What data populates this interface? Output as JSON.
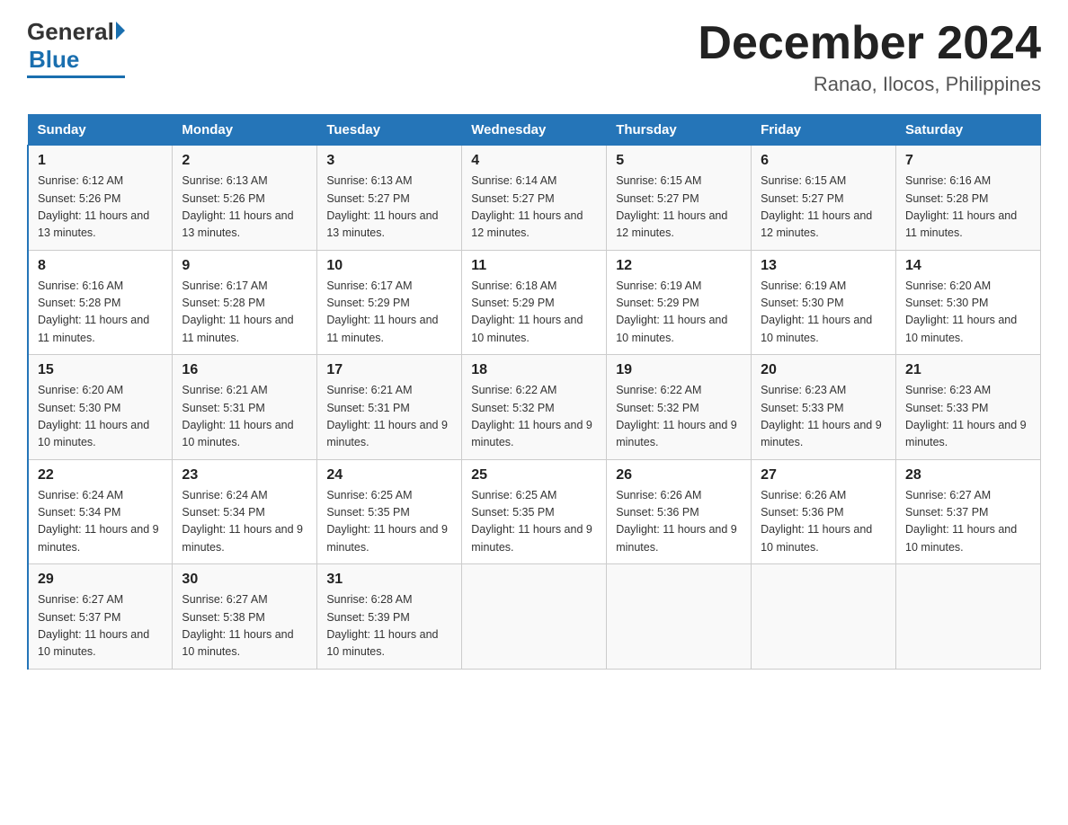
{
  "logo": {
    "general": "General",
    "blue": "Blue"
  },
  "title": "December 2024",
  "location": "Ranao, Ilocos, Philippines",
  "days_of_week": [
    "Sunday",
    "Monday",
    "Tuesday",
    "Wednesday",
    "Thursday",
    "Friday",
    "Saturday"
  ],
  "weeks": [
    [
      {
        "day": "1",
        "sunrise": "Sunrise: 6:12 AM",
        "sunset": "Sunset: 5:26 PM",
        "daylight": "Daylight: 11 hours and 13 minutes."
      },
      {
        "day": "2",
        "sunrise": "Sunrise: 6:13 AM",
        "sunset": "Sunset: 5:26 PM",
        "daylight": "Daylight: 11 hours and 13 minutes."
      },
      {
        "day": "3",
        "sunrise": "Sunrise: 6:13 AM",
        "sunset": "Sunset: 5:27 PM",
        "daylight": "Daylight: 11 hours and 13 minutes."
      },
      {
        "day": "4",
        "sunrise": "Sunrise: 6:14 AM",
        "sunset": "Sunset: 5:27 PM",
        "daylight": "Daylight: 11 hours and 12 minutes."
      },
      {
        "day": "5",
        "sunrise": "Sunrise: 6:15 AM",
        "sunset": "Sunset: 5:27 PM",
        "daylight": "Daylight: 11 hours and 12 minutes."
      },
      {
        "day": "6",
        "sunrise": "Sunrise: 6:15 AM",
        "sunset": "Sunset: 5:27 PM",
        "daylight": "Daylight: 11 hours and 12 minutes."
      },
      {
        "day": "7",
        "sunrise": "Sunrise: 6:16 AM",
        "sunset": "Sunset: 5:28 PM",
        "daylight": "Daylight: 11 hours and 11 minutes."
      }
    ],
    [
      {
        "day": "8",
        "sunrise": "Sunrise: 6:16 AM",
        "sunset": "Sunset: 5:28 PM",
        "daylight": "Daylight: 11 hours and 11 minutes."
      },
      {
        "day": "9",
        "sunrise": "Sunrise: 6:17 AM",
        "sunset": "Sunset: 5:28 PM",
        "daylight": "Daylight: 11 hours and 11 minutes."
      },
      {
        "day": "10",
        "sunrise": "Sunrise: 6:17 AM",
        "sunset": "Sunset: 5:29 PM",
        "daylight": "Daylight: 11 hours and 11 minutes."
      },
      {
        "day": "11",
        "sunrise": "Sunrise: 6:18 AM",
        "sunset": "Sunset: 5:29 PM",
        "daylight": "Daylight: 11 hours and 10 minutes."
      },
      {
        "day": "12",
        "sunrise": "Sunrise: 6:19 AM",
        "sunset": "Sunset: 5:29 PM",
        "daylight": "Daylight: 11 hours and 10 minutes."
      },
      {
        "day": "13",
        "sunrise": "Sunrise: 6:19 AM",
        "sunset": "Sunset: 5:30 PM",
        "daylight": "Daylight: 11 hours and 10 minutes."
      },
      {
        "day": "14",
        "sunrise": "Sunrise: 6:20 AM",
        "sunset": "Sunset: 5:30 PM",
        "daylight": "Daylight: 11 hours and 10 minutes."
      }
    ],
    [
      {
        "day": "15",
        "sunrise": "Sunrise: 6:20 AM",
        "sunset": "Sunset: 5:30 PM",
        "daylight": "Daylight: 11 hours and 10 minutes."
      },
      {
        "day": "16",
        "sunrise": "Sunrise: 6:21 AM",
        "sunset": "Sunset: 5:31 PM",
        "daylight": "Daylight: 11 hours and 10 minutes."
      },
      {
        "day": "17",
        "sunrise": "Sunrise: 6:21 AM",
        "sunset": "Sunset: 5:31 PM",
        "daylight": "Daylight: 11 hours and 9 minutes."
      },
      {
        "day": "18",
        "sunrise": "Sunrise: 6:22 AM",
        "sunset": "Sunset: 5:32 PM",
        "daylight": "Daylight: 11 hours and 9 minutes."
      },
      {
        "day": "19",
        "sunrise": "Sunrise: 6:22 AM",
        "sunset": "Sunset: 5:32 PM",
        "daylight": "Daylight: 11 hours and 9 minutes."
      },
      {
        "day": "20",
        "sunrise": "Sunrise: 6:23 AM",
        "sunset": "Sunset: 5:33 PM",
        "daylight": "Daylight: 11 hours and 9 minutes."
      },
      {
        "day": "21",
        "sunrise": "Sunrise: 6:23 AM",
        "sunset": "Sunset: 5:33 PM",
        "daylight": "Daylight: 11 hours and 9 minutes."
      }
    ],
    [
      {
        "day": "22",
        "sunrise": "Sunrise: 6:24 AM",
        "sunset": "Sunset: 5:34 PM",
        "daylight": "Daylight: 11 hours and 9 minutes."
      },
      {
        "day": "23",
        "sunrise": "Sunrise: 6:24 AM",
        "sunset": "Sunset: 5:34 PM",
        "daylight": "Daylight: 11 hours and 9 minutes."
      },
      {
        "day": "24",
        "sunrise": "Sunrise: 6:25 AM",
        "sunset": "Sunset: 5:35 PM",
        "daylight": "Daylight: 11 hours and 9 minutes."
      },
      {
        "day": "25",
        "sunrise": "Sunrise: 6:25 AM",
        "sunset": "Sunset: 5:35 PM",
        "daylight": "Daylight: 11 hours and 9 minutes."
      },
      {
        "day": "26",
        "sunrise": "Sunrise: 6:26 AM",
        "sunset": "Sunset: 5:36 PM",
        "daylight": "Daylight: 11 hours and 9 minutes."
      },
      {
        "day": "27",
        "sunrise": "Sunrise: 6:26 AM",
        "sunset": "Sunset: 5:36 PM",
        "daylight": "Daylight: 11 hours and 10 minutes."
      },
      {
        "day": "28",
        "sunrise": "Sunrise: 6:27 AM",
        "sunset": "Sunset: 5:37 PM",
        "daylight": "Daylight: 11 hours and 10 minutes."
      }
    ],
    [
      {
        "day": "29",
        "sunrise": "Sunrise: 6:27 AM",
        "sunset": "Sunset: 5:37 PM",
        "daylight": "Daylight: 11 hours and 10 minutes."
      },
      {
        "day": "30",
        "sunrise": "Sunrise: 6:27 AM",
        "sunset": "Sunset: 5:38 PM",
        "daylight": "Daylight: 11 hours and 10 minutes."
      },
      {
        "day": "31",
        "sunrise": "Sunrise: 6:28 AM",
        "sunset": "Sunset: 5:39 PM",
        "daylight": "Daylight: 11 hours and 10 minutes."
      },
      null,
      null,
      null,
      null
    ]
  ]
}
